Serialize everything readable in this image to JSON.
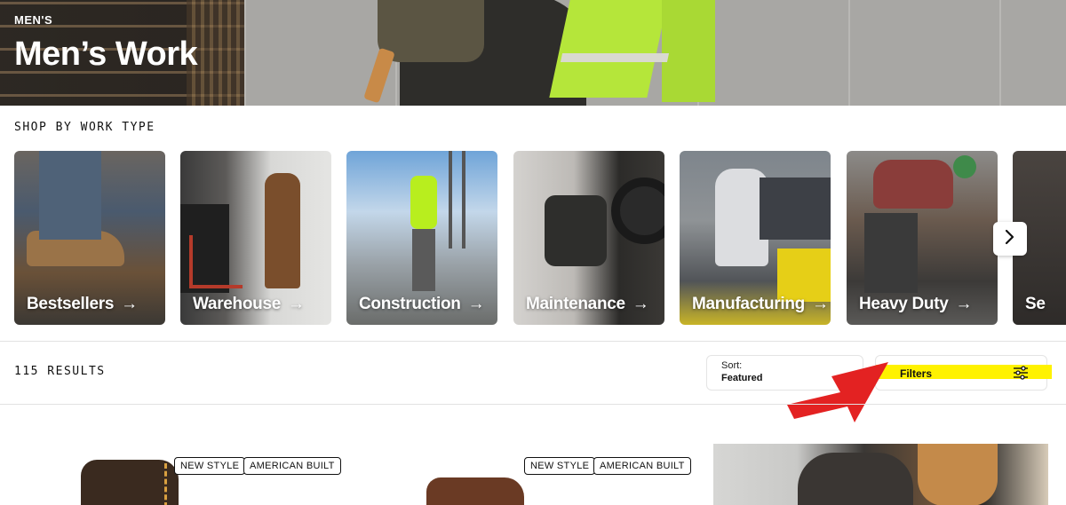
{
  "hero": {
    "category": "MEN'S",
    "title": "Men’s Work"
  },
  "shop_by": {
    "heading": "SHOP BY WORK TYPE",
    "arrow": "→",
    "cards": [
      {
        "label": "Bestsellers"
      },
      {
        "label": "Warehouse"
      },
      {
        "label": "Construction"
      },
      {
        "label": "Maintenance"
      },
      {
        "label": "Manufacturing"
      },
      {
        "label": "Heavy Duty"
      },
      {
        "label": "Se"
      }
    ],
    "next_icon": "chevron-right-icon"
  },
  "results": {
    "count_text": "115 RESULTS"
  },
  "sort": {
    "label": "Sort:",
    "value": "Featured"
  },
  "filters": {
    "label": "Filters",
    "icon": "sliders-icon",
    "highlight_color": "#fff200"
  },
  "annotation": {
    "arrow_color": "#e32222"
  },
  "products": [
    {
      "badges": [
        "NEW STYLE",
        "AMERICAN BUILT"
      ]
    },
    {
      "badges": [
        "NEW STYLE",
        "AMERICAN BUILT"
      ]
    }
  ]
}
